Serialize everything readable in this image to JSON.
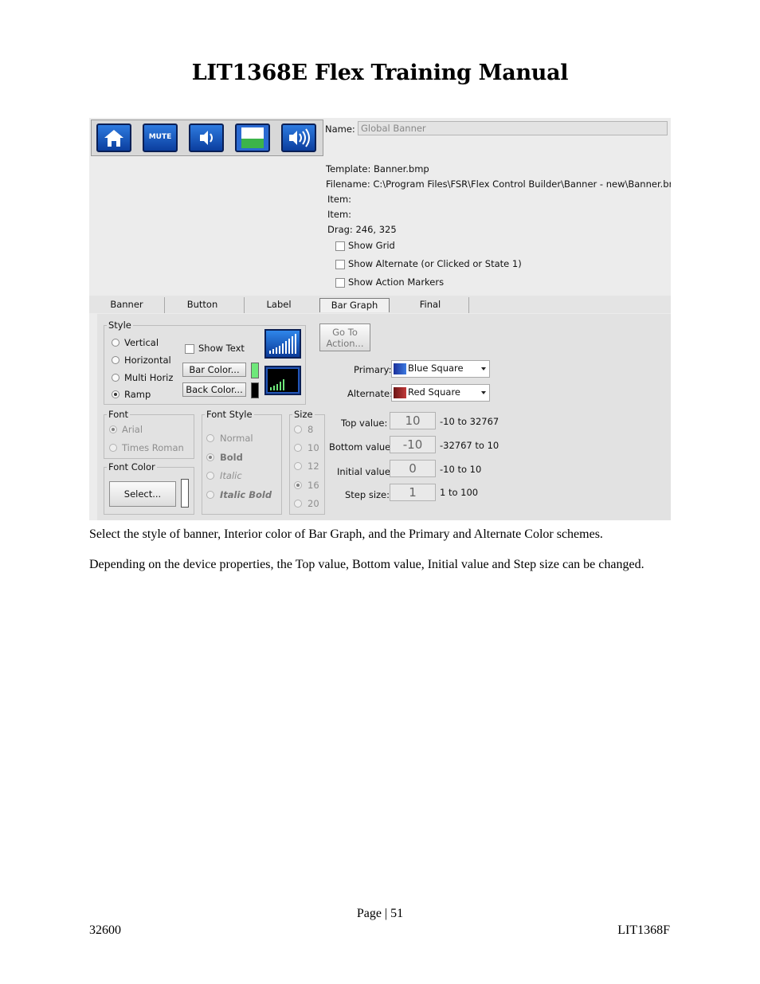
{
  "document": {
    "title": "LIT1368E Flex Training Manual",
    "paragraphs": [
      "Select the style of banner, Interior color of Bar Graph, and the Primary and Alternate Color schemes.",
      "Depending on the device properties, the Top value, Bottom value, Initial value and Step size can be changed."
    ],
    "footer": {
      "page": "Page | 51",
      "left": "32600",
      "right": "LIT1368F"
    }
  },
  "toolbar": {
    "icons": [
      "home-icon",
      "mute-icon",
      "volume-down-icon",
      "level-icon",
      "volume-up-icon"
    ],
    "mute_label": "MUTE"
  },
  "info": {
    "name_label": "Name:",
    "name_value": "Global Banner",
    "template": "Template: Banner.bmp",
    "filename": "Filename: C:\\Program Files\\FSR\\Flex Control Builder\\Banner - new\\Banner.bmp",
    "item1": "Item:",
    "item2": "Item:",
    "drag": "Drag: 246, 325",
    "show_grid": "Show Grid",
    "show_alternate": "Show Alternate (or Clicked or State 1)",
    "show_action_markers": "Show Action Markers"
  },
  "tabs": [
    "Banner",
    "Button",
    "Label",
    "Bar Graph",
    "Final"
  ],
  "active_tab": "Bar Graph",
  "style_group": {
    "label": "Style",
    "options": [
      "Vertical",
      "Horizontal",
      "Multi Horiz",
      "Ramp"
    ],
    "selected": "Ramp",
    "show_text": "Show Text",
    "bar_color_button": "Bar Color...",
    "back_color_button": "Back Color...",
    "bar_color": "#6ee87a",
    "back_color": "#000000"
  },
  "goto_button": [
    "Go To",
    "Action..."
  ],
  "colors": {
    "primary_label": "Primary:",
    "primary_value": "Blue Square",
    "alternate_label": "Alternate:",
    "alternate_value": "Red Square"
  },
  "font_group": {
    "label": "Font",
    "options": [
      "Arial",
      "Times Roman"
    ],
    "selected": "Arial"
  },
  "font_color_group": {
    "label": "Font Color",
    "select_button": "Select..."
  },
  "font_style_group": {
    "label": "Font Style",
    "options": [
      "Normal",
      "Bold",
      "Italic",
      "Italic Bold"
    ],
    "selected": "Bold"
  },
  "size_group": {
    "label": "Size",
    "options": [
      "8",
      "10",
      "12",
      "16",
      "20"
    ],
    "selected": "16"
  },
  "values": [
    {
      "label": "Top value:",
      "value": "10",
      "range": "-10 to 32767"
    },
    {
      "label": "Bottom value:",
      "value": "-10",
      "range": "-32767 to 10"
    },
    {
      "label": "Initial value:",
      "value": "0",
      "range": "-10 to 10"
    },
    {
      "label": "Step size:",
      "value": "1",
      "range": "1 to 100"
    }
  ]
}
